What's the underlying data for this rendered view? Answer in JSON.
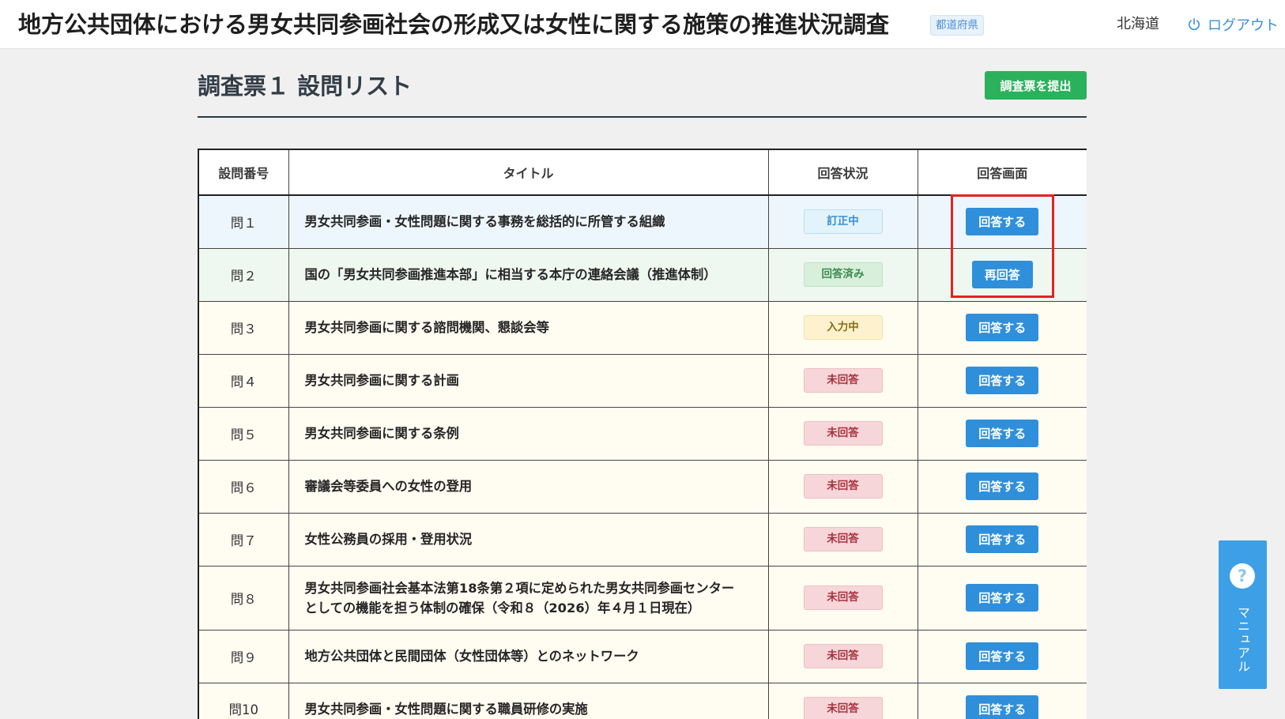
{
  "header": {
    "title": "地方公共団体における男女共同参画社会の形成又は女性に関する施策の推進状況調査",
    "badge": "都道府県",
    "user": "北海道",
    "logout_label": "ログアウト",
    "logout_icon": "power-icon"
  },
  "page": {
    "title": "調査票１ 設問リスト",
    "submit_label": "調査票を提出"
  },
  "table": {
    "columns": [
      "設問番号",
      "タイトル",
      "回答状況",
      "回答画面"
    ],
    "rows": [
      {
        "number": "問１",
        "title": "男女共同参画・女性問題に関する事務を総括的に所管する組織",
        "status": "訂正中",
        "action": "回答する"
      },
      {
        "number": "問２",
        "title": "国の「男女共同参画推進本部」に相当する本庁の連絡会議（推進体制）",
        "status": "回答済み",
        "action": "再回答"
      },
      {
        "number": "問３",
        "title": "男女共同参画に関する諮問機関、懇談会等",
        "status": "入力中",
        "action": "回答する"
      },
      {
        "number": "問４",
        "title": "男女共同参画に関する計画",
        "status": "未回答",
        "action": "回答する"
      },
      {
        "number": "問５",
        "title": "男女共同参画に関する条例",
        "status": "未回答",
        "action": "回答する"
      },
      {
        "number": "問６",
        "title": "審議会等委員への女性の登用",
        "status": "未回答",
        "action": "回答する"
      },
      {
        "number": "問７",
        "title": "女性公務員の採用・登用状況",
        "status": "未回答",
        "action": "回答する"
      },
      {
        "number": "問８",
        "title": "男女共同参画社会基本法第18条第２項に定められた男女共同参画センターとしての機能を担う体制の確保（令和８（2026）年４月１日現在）",
        "status": "未回答",
        "action": "回答する"
      },
      {
        "number": "問９",
        "title": "地方公共団体と民間団体（女性団体等）とのネットワーク",
        "status": "未回答",
        "action": "回答する"
      },
      {
        "number": "問10",
        "title": "男女共同参画・女性問題に関する職員研修の実施",
        "status": "未回答",
        "action": "回答する"
      }
    ]
  },
  "status_styles": {
    "訂正中": {
      "bg": "#e2f3fc",
      "border": "#b9def3",
      "fg": "#3a8fd0",
      "row_bg": "#edf6fc"
    },
    "回答済み": {
      "bg": "#d8efdb",
      "border": "#bfe3c4",
      "fg": "#3d8a4f",
      "row_bg": "#eef7f0"
    },
    "入力中": {
      "bg": "#fdf2cd",
      "border": "#f3e3a6",
      "fg": "#8d6c14",
      "row_bg": "#fffcf2"
    },
    "未回答": {
      "bg": "#f7d6d9",
      "border": "#efbfc4",
      "fg": "#a8323f",
      "row_bg": "#fffcf2"
    }
  },
  "manual": {
    "label": "マニュアル",
    "icon": "question-circle-icon"
  },
  "colors": {
    "accent_blue": "#2f8fda",
    "link_blue": "#3b8fd9",
    "submit_green": "#2bb15c",
    "highlight_red": "#e3231f",
    "manual_blue": "#3d9fe6"
  }
}
